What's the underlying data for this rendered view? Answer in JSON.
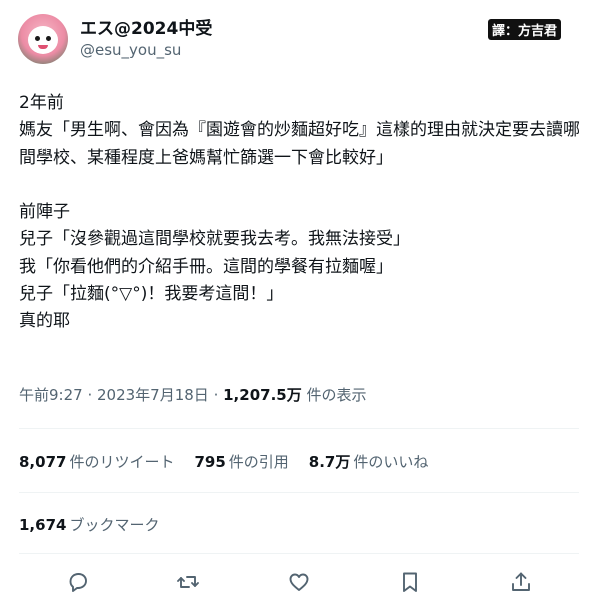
{
  "author": {
    "display_name": "エス@2024中受",
    "handle": "@esu_you_su"
  },
  "credit": "譯：方吉君",
  "tweet": {
    "text": "2年前\n媽友「男生啊、會因為『園遊會的炒麵超好吃』這樣的理由就決定要去讀哪間學校、某種程度上爸媽幫忙篩選一下會比較好」\n\n前陣子\n兒子「沒參觀過這間學校就要我去考。我無法接受」\n我「你看他們的介紹手冊。這間的學餐有拉麵喔」\n兒子「拉麵(°▽°)！我要考這間！」\n真的耶"
  },
  "meta": {
    "time": "午前9:27",
    "sep1": " · ",
    "date": "2023年7月18日",
    "sep2": " · ",
    "views_count": "1,207.5万",
    "views_label": " 件の表示"
  },
  "stats": {
    "retweets_count": "8,077",
    "retweets_label": "件のリツイート",
    "quotes_count": "795",
    "quotes_label": "件の引用",
    "likes_count": "8.7万",
    "likes_label": "件のいいね"
  },
  "bookmarks": {
    "count": "1,674",
    "label": "ブックマーク"
  },
  "actions": [
    "reply-icon",
    "retweet-icon",
    "like-icon",
    "bookmark-icon",
    "share-icon"
  ],
  "colors": {
    "text": "#0f1419",
    "muted": "#536471",
    "divider": "#eff3f4"
  }
}
